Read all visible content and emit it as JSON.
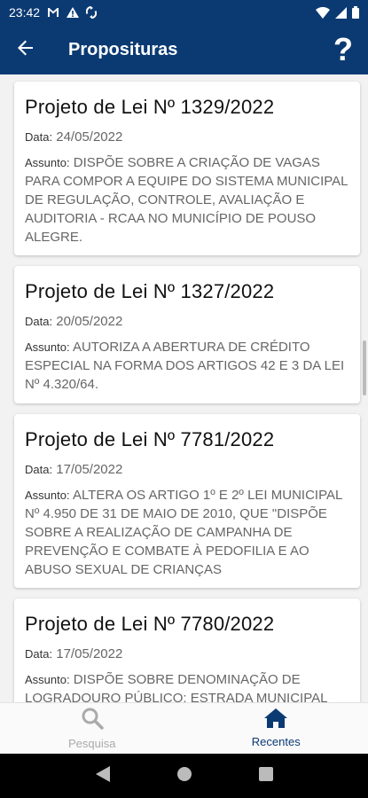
{
  "status_bar": {
    "time": "23:42",
    "icons": [
      "gmail-icon",
      "alert-icon",
      "sync-icon",
      "wifi-icon",
      "signal-icon",
      "battery-icon"
    ],
    "bg_color": "#0b3a73"
  },
  "app_bar": {
    "title": "Proposituras",
    "back_icon": "arrow-back-icon",
    "help_icon": "question-mark-icon",
    "help_glyph": "?"
  },
  "cards": [
    {
      "title": "Projeto de Lei Nº 1329/2022",
      "data_label": "Data:",
      "data_value": "24/05/2022",
      "assunto_label": "Assunto:",
      "assunto_value": "DISPÕE SOBRE A CRIAÇÃO DE VAGAS PARA COMPOR A EQUIPE DO SISTEMA MUNICIPAL DE REGULAÇÃO, CONTROLE, AVALIAÇÃO E AUDITORIA - RCAA NO MUNICÍPIO DE POUSO ALEGRE."
    },
    {
      "title": "Projeto de Lei Nº 1327/2022",
      "data_label": "Data:",
      "data_value": "20/05/2022",
      "assunto_label": "Assunto:",
      "assunto_value": "AUTORIZA A ABERTURA DE CRÉDITO ESPECIAL NA FORMA DOS ARTIGOS 42 E 3 DA LEI Nº 4.320/64."
    },
    {
      "title": "Projeto de Lei Nº 7781/2022",
      "data_label": "Data:",
      "data_value": "17/05/2022",
      "assunto_label": "Assunto:",
      "assunto_value": "ALTERA OS ARTIGO 1º E 2º LEI MUNICIPAL Nº 4.950 DE 31 DE MAIO DE 2010, QUE \"DISPÕE SOBRE A REALIZAÇÃO DE CAMPANHA DE PREVENÇÃO E COMBATE À PEDOFILIA E AO ABUSO SEXUAL DE CRIANÇAS"
    },
    {
      "title": "Projeto de Lei Nº 7780/2022",
      "data_label": "Data:",
      "data_value": "17/05/2022",
      "assunto_label": "Assunto:",
      "assunto_value": "DISPÕE SOBRE DENOMINAÇÃO DE LOGRADOURO PÚBLICO: ESTRADA MUNICIPAL"
    }
  ],
  "bottom_nav": {
    "items": [
      {
        "label": "Pesquisa",
        "icon": "search-icon",
        "active": false
      },
      {
        "label": "Recentes",
        "icon": "home-icon",
        "active": true
      }
    ],
    "active_color": "#0b3a73",
    "inactive_color": "#aaaaaa"
  },
  "system_nav": {
    "icons": [
      "back-triangle-icon",
      "home-circle-icon",
      "recents-square-icon"
    ]
  }
}
